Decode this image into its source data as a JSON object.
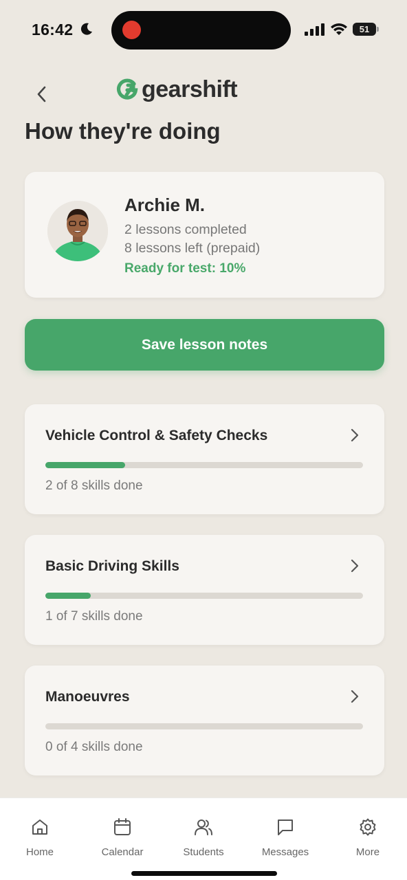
{
  "status_bar": {
    "time": "16:42",
    "battery": "51",
    "icons": [
      "moon-icon",
      "cellular-signal-icon",
      "wifi-icon",
      "battery-icon"
    ]
  },
  "header": {
    "back_icon": "chevron-left-icon",
    "logo_text": "gearshift",
    "title": "How they're doing"
  },
  "student": {
    "name": "Archie M.",
    "lessons_completed": "2 lessons completed",
    "lessons_left": "8 lessons left (prepaid)",
    "ready_for_test": "Ready for test: 10%",
    "ready_percent": 10
  },
  "actions": {
    "save_label": "Save lesson notes"
  },
  "skills": [
    {
      "title": "Vehicle Control & Safety Checks",
      "summary": "2 of 8 skills done",
      "done": 2,
      "total": 8
    },
    {
      "title": "Basic Driving Skills",
      "summary": "1 of 7 skills done",
      "done": 1,
      "total": 7
    },
    {
      "title": "Manoeuvres",
      "summary": "0 of 4 skills done",
      "done": 0,
      "total": 4
    }
  ],
  "tabs": [
    {
      "label": "Home",
      "icon": "home-icon"
    },
    {
      "label": "Calendar",
      "icon": "calendar-icon"
    },
    {
      "label": "Students",
      "icon": "students-icon"
    },
    {
      "label": "Messages",
      "icon": "message-icon"
    },
    {
      "label": "More",
      "icon": "gear-icon"
    }
  ],
  "colors": {
    "accent": "#47a66a",
    "background": "#ece8e1",
    "card": "#f7f5f2"
  }
}
